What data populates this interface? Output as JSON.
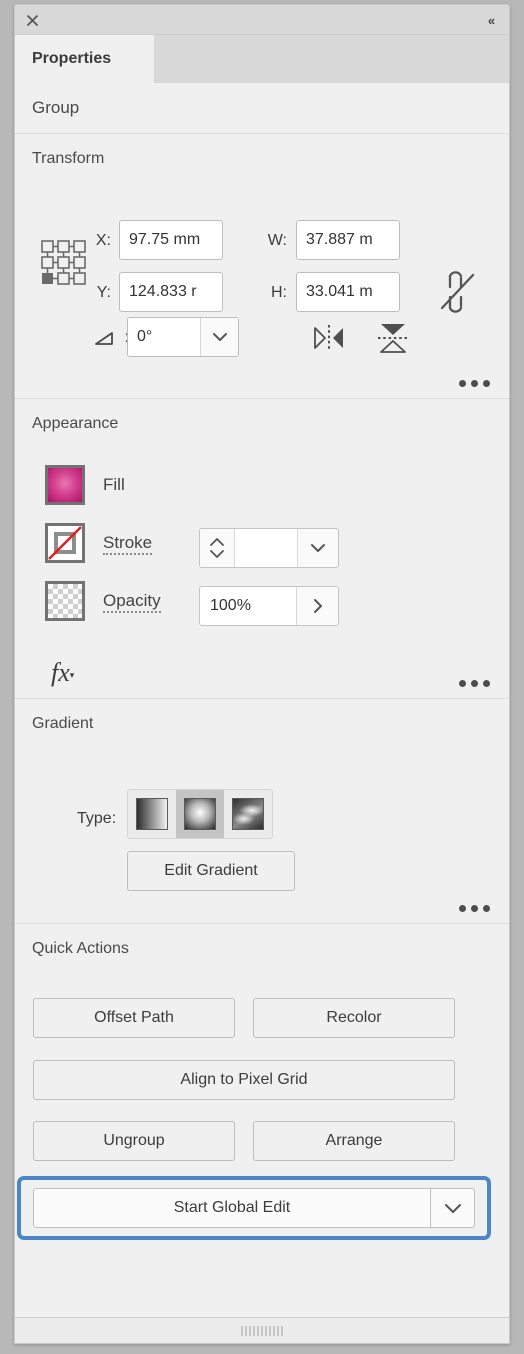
{
  "window": {
    "close_icon": "close-icon",
    "collapse_icon": "collapse-panel-icon",
    "collapse_glyph": "«",
    "close_glyph": "✕"
  },
  "tabs": [
    {
      "label": "Properties",
      "active": true
    }
  ],
  "object": {
    "type_label": "Group"
  },
  "transform": {
    "title": "Transform",
    "reference_point": "bottom-left",
    "fields": [
      {
        "label": "X:",
        "value": "97.75 mm"
      },
      {
        "label": "W:",
        "value": "37.887 m"
      },
      {
        "label": "Y:",
        "value": "124.833 r"
      },
      {
        "label": "H:",
        "value": "33.041 m"
      }
    ],
    "angle": {
      "label": "angle-icon",
      "value": "0°"
    },
    "link_icon": "broken-link-icon",
    "flip_horizontal_icon": "flip-horizontal-icon",
    "flip_vertical_icon": "flip-vertical-icon",
    "more_label": "more-options-icon"
  },
  "appearance": {
    "title": "Appearance",
    "fill": {
      "label": "Fill",
      "swatch": "radial-gradient-magenta",
      "color_center": "#e06aa8",
      "color_edge": "#b5146e"
    },
    "stroke": {
      "label": "Stroke",
      "swatch": "none-swatch",
      "value": "",
      "none_color": "#e02020"
    },
    "opacity": {
      "label": "Opacity",
      "swatch": "checkerboard-swatch",
      "value": "100%"
    },
    "fx": {
      "label": "fx",
      "triangle": "▾"
    },
    "more_label": "more-options-icon"
  },
  "gradient": {
    "title": "Gradient",
    "type_label": "Type:",
    "types": [
      {
        "name": "linear-gradient",
        "selected": false
      },
      {
        "name": "radial-gradient",
        "selected": true
      },
      {
        "name": "freeform-gradient",
        "selected": false
      }
    ],
    "edit_button": "Edit Gradient",
    "more_label": "more-options-icon"
  },
  "quick_actions": {
    "title": "Quick Actions",
    "buttons": [
      {
        "label": "Offset Path"
      },
      {
        "label": "Recolor"
      },
      {
        "label": "Align to Pixel Grid"
      },
      {
        "label": "Ungroup"
      },
      {
        "label": "Arrange"
      }
    ],
    "global_edit": {
      "label": "Start Global Edit",
      "dropdown_glyph": "⌄",
      "focused": true,
      "focus_color": "#4a86c8"
    }
  },
  "footer": {
    "grip": "panel-resize-grip"
  }
}
